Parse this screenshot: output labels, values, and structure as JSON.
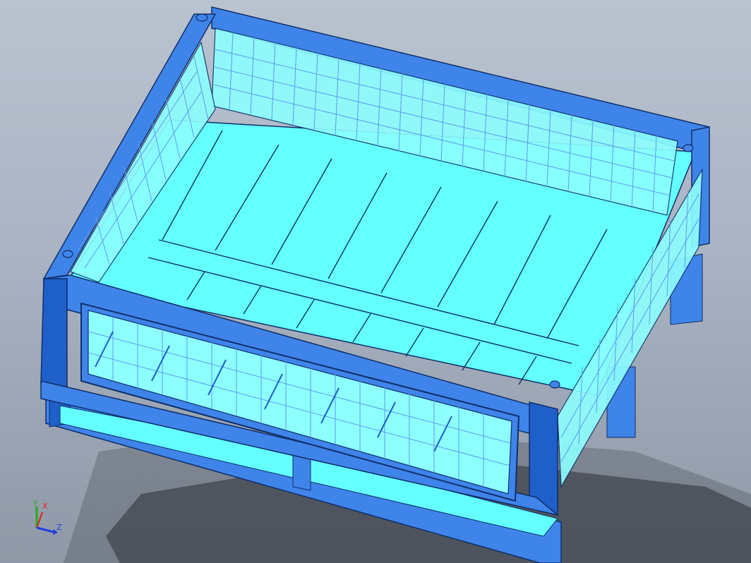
{
  "viewport": {
    "background_top": "#b9c3d0",
    "background_bottom": "#8f98a6"
  },
  "model": {
    "subject": "pallet-cage-box-with-wire-mesh-sides",
    "frame_color": "#3f84e9",
    "frame_dark": "#1f5fc9",
    "panel_color": "#64ffff",
    "panel_light": "#8dffff",
    "edge_color": "#0f2f6a",
    "mesh_color": "#5c9bf0",
    "shadow_color": "#4a4f58"
  },
  "triad": {
    "x_label": "X",
    "y_label": "Y",
    "z_label": "Z",
    "x_color": "#e02020",
    "y_color": "#20b020",
    "z_color": "#2040e0"
  }
}
